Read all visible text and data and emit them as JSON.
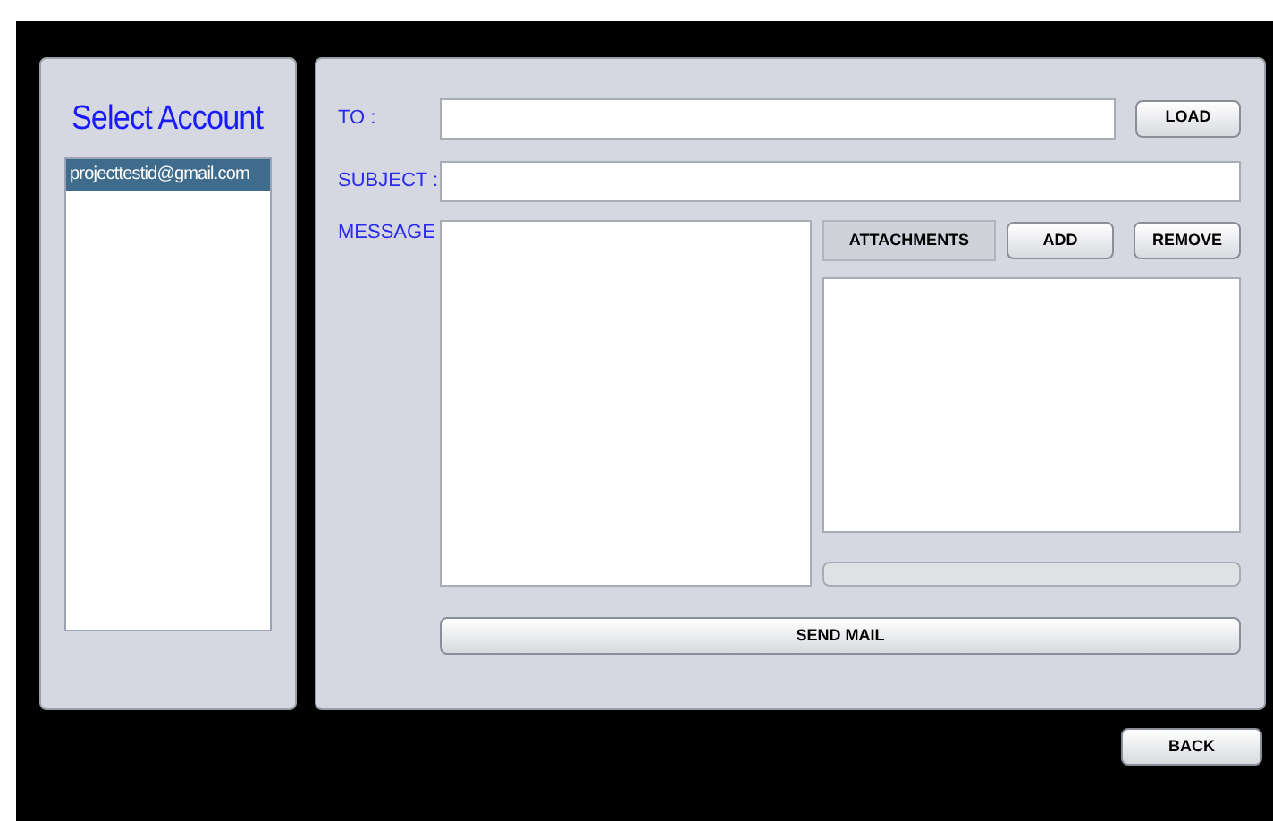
{
  "account_panel": {
    "title": "Select Account",
    "accounts": [
      {
        "label": "projecttestid@gmail.com",
        "selected": true
      }
    ]
  },
  "compose": {
    "to_label": "TO :",
    "load_button": "LOAD",
    "subject_label": "SUBJECT :",
    "message_label": "MESSAGE",
    "attachments_label": "ATTACHMENTS",
    "add_button": "ADD",
    "remove_button": "REMOVE",
    "progress": {
      "level": 0
    },
    "send_button": "SEND MAIL"
  },
  "back_button": "BACK"
}
